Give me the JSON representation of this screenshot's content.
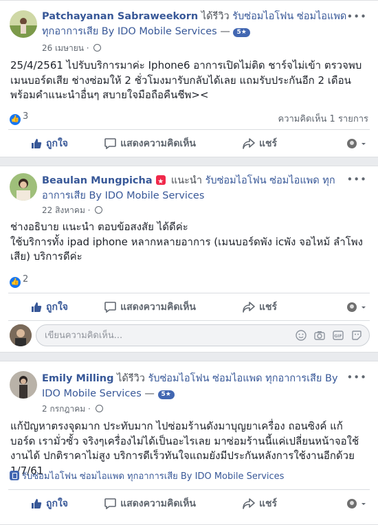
{
  "posts": [
    {
      "name": "Patchayanan Sabraweekorn",
      "verb": "ได้รีวิว",
      "page": "รับซ่อมไอโฟน ซ่อมไอแพด ทุกอาการเสีย By IDO Mobile Services",
      "rating": "5★",
      "date": "26 เมษายน",
      "body": "25/4/2561 ไปรับบริการมาค่ะ Iphone6 อาการเปิดไม่ติด ชาร์จไม่เข้า ตรวจพบ เมนบอร์ดเสีย ช่างซ่อมให้ 2 ชั่วโมงมารับกลับได้เลย แถมรับประกันอีก 2 เดือน พร้อมคำแนะนำอื่นๆ สบายใจมือถือคืนชีพ><",
      "likes": "3",
      "comments": "ความคิดเห็น 1 รายการ"
    },
    {
      "name": "Beaulan Mungpicha",
      "verb": "แนะนำ",
      "page": "รับซ่อมไอโฟน ซ่อมไอแพด ทุกอาการเสีย By IDO Mobile Services",
      "date": "22 สิงหาคม",
      "body_line1": "ช่างอธิบาย แนะนำ ตอบข้อสงสัย ได้ดีค่ะ",
      "body_line2": "ใช้บริการทั้ง ipad iphone หลากหลายอาการ (เมนบอร์ดพัง icพัง จอไหม้ ลำโพงเสีย) บริการดีค่ะ",
      "likes": "2",
      "comment_placeholder": "เขียนความคิดเห็น..."
    },
    {
      "name": "Emily Milling",
      "verb": "ได้รีวิว",
      "page": "รับซ่อมไอโฟน ซ่อมไอแพด ทุกอาการเสีย By IDO Mobile Services",
      "rating": "5★",
      "date": "2 กรกฎาคม",
      "body": "แก้ปัญหาตรงจุดมาก ประทับมาก ไปซ่อมร้านดังมาบุญยาเครื่อง ถอนซิงค์ แก้บอร์ด เรามั่วซั้ว จริงๆเครื่องไม่ได้เป็นอะไรเลย มาซ่อมร้านนี้แค่เปลี่ยนหน้าจอใช้งานได้ ปกติราคาไม่สูง บริการดีเร็วทันใจแถมยังมีประกันหลังการใช้งานอีกด้วย 1/7/61",
      "tag": "รับซ่อมไอโฟน ซ่อมไอแพด ทุกอาการเสีย By IDO Mobile Services"
    }
  ],
  "actions": {
    "like": "ถูกใจ",
    "comment": "แสดงความคิดเห็น",
    "share": "แชร์"
  },
  "more_label": "•••",
  "icons": [
    "globe-icon",
    "thumbs-up-icon",
    "comment-icon",
    "share-icon",
    "audience-icon",
    "emoji-icon",
    "camera-icon",
    "gif-icon",
    "sticker-icon",
    "recommend-icon"
  ],
  "colors": {
    "link": "#385898",
    "like_blue": "#1877f2",
    "recommend_red": "#f0284a"
  }
}
